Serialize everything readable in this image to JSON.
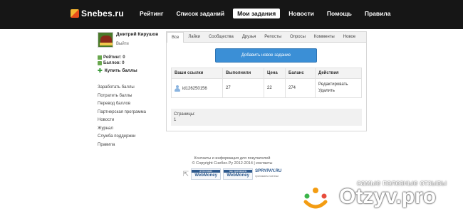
{
  "logo": {
    "text": "Snebes.ru"
  },
  "nav": [
    {
      "label": "Рейтинг",
      "active": false
    },
    {
      "label": "Список заданий",
      "active": false
    },
    {
      "label": "Мои задания",
      "active": true
    },
    {
      "label": "Новости",
      "active": false
    },
    {
      "label": "Помощь",
      "active": false
    },
    {
      "label": "Правила",
      "active": false
    }
  ],
  "profile": {
    "name": "Дмитрий Кирушов",
    "logout": "Выйти",
    "rating": "Рейтинг: 0",
    "balance": "Баллов: 0",
    "buy": "Купить баллы"
  },
  "menu": [
    "Заработать баллы",
    "Потратить баллы",
    "Перевод баллов",
    "Партнерская программа",
    "Новости",
    "Журнал",
    "Служба поддержки",
    "Правила"
  ],
  "tabs": [
    {
      "label": "Все",
      "active": true
    },
    {
      "label": "Лайки",
      "active": false
    },
    {
      "label": "Сообщества",
      "active": false
    },
    {
      "label": "Друзья",
      "active": false
    },
    {
      "label": "Репосты",
      "active": false
    },
    {
      "label": "Опросы",
      "active": false
    },
    {
      "label": "Комменты",
      "active": false
    },
    {
      "label": "Новое",
      "active": false
    }
  ],
  "add_button": "Добавить новое задание",
  "table": {
    "headers": [
      "Ваши ссылки",
      "Выполнили",
      "Цена",
      "Баланс",
      "Действия"
    ],
    "rows": [
      {
        "link": "id126250156",
        "done": "27",
        "price": "22",
        "balance": "274",
        "edit": "Редактировать",
        "delete": "Удалить"
      }
    ]
  },
  "pagination": {
    "label": "Страницы:",
    "current": "1"
  },
  "footer": {
    "line1": "Контакты и информация для покупателей",
    "line2": "© Copyright Снебес.Ру 2012-2014 | контакты",
    "wm1_top": "аттестован",
    "wm2_top": "мы принимаем",
    "wm_text": "WebMoney",
    "spry": "SPRYPAY.RU",
    "spry_sub": "принимаем платежи"
  },
  "watermark": {
    "tagline": "самые полезные отзывы",
    "brand": "Otzyv.pro"
  },
  "colors": {
    "topbar": "#161616",
    "accent": "#3b8fd6"
  }
}
